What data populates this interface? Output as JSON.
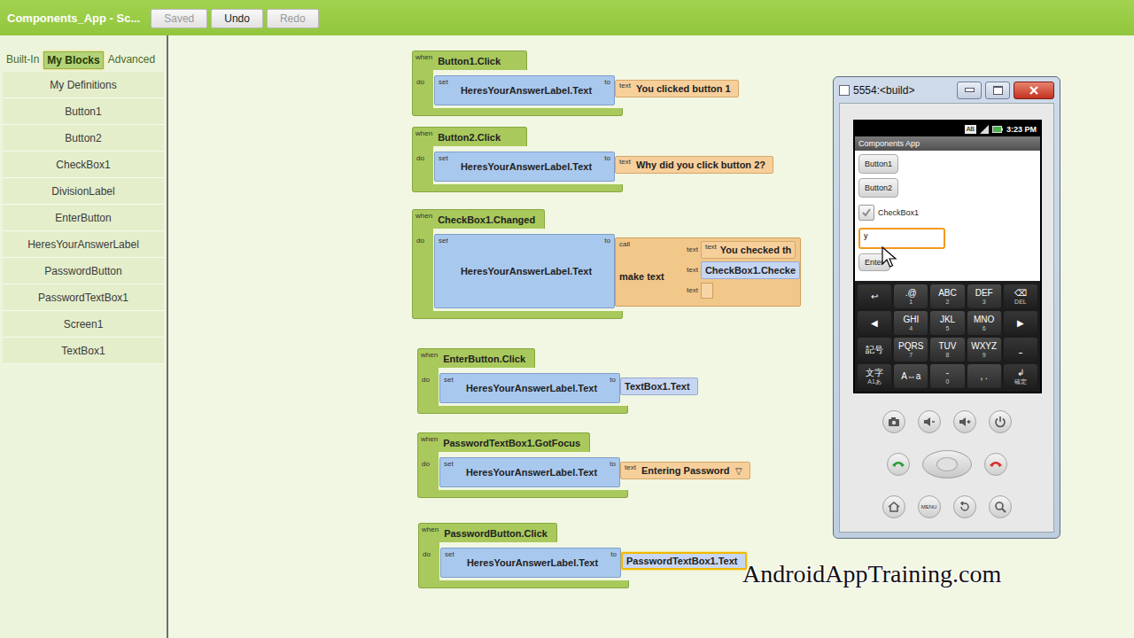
{
  "top_bar": {
    "title": "Components_App - Sc...",
    "buttons": [
      {
        "label": "Saved",
        "disabled": true
      },
      {
        "label": "Undo",
        "disabled": false
      },
      {
        "label": "Redo",
        "disabled": true
      }
    ]
  },
  "sidebar": {
    "tabs": [
      {
        "label": "Built-In",
        "selected": false
      },
      {
        "label": "My Blocks",
        "selected": true
      },
      {
        "label": "Advanced",
        "selected": false
      }
    ],
    "items": [
      "My Definitions",
      "Button1",
      "Button2",
      "CheckBox1",
      "DivisionLabel",
      "EnterButton",
      "HeresYourAnswerLabel",
      "PasswordButton",
      "PasswordTextBox1",
      "Screen1",
      "TextBox1"
    ]
  },
  "block_labels": {
    "when": "when",
    "do": "do",
    "set": "set",
    "to": "to",
    "text": "text",
    "call": "call"
  },
  "blocks": [
    {
      "event": "Button1.Click",
      "target": "HeresYourAnswerLabel.Text",
      "value": {
        "kind": "text",
        "text": "You clicked button 1",
        "selected": false
      }
    },
    {
      "event": "Button2.Click",
      "target": "HeresYourAnswerLabel.Text",
      "value": {
        "kind": "text",
        "text": "Why did you click button 2?",
        "selected": false
      }
    },
    {
      "event": "CheckBox1.Changed",
      "target": "HeresYourAnswerLabel.Text",
      "value": {
        "kind": "call",
        "text": "make text",
        "selected": false,
        "args": [
          {
            "kind": "text",
            "text": "You checked th"
          },
          {
            "kind": "getter",
            "text": "CheckBox1.Checke"
          },
          {
            "kind": "empty",
            "text": ""
          }
        ]
      }
    },
    {
      "event": "EnterButton.Click",
      "target": "HeresYourAnswerLabel.Text",
      "value": {
        "kind": "getter",
        "text": "TextBox1.Text",
        "selected": false
      }
    },
    {
      "event": "PasswordTextBox1.GotFocus",
      "target": "HeresYourAnswerLabel.Text",
      "value": {
        "kind": "text",
        "text": "Entering Password",
        "dropdown": "▽",
        "selected": false
      }
    },
    {
      "event": "PasswordButton.Click",
      "target": "HeresYourAnswerLabel.Text",
      "value": {
        "kind": "getter",
        "text": "PasswordTextBox1.Text",
        "selected": true
      }
    }
  ],
  "emulator": {
    "title": "5554:<build>",
    "phone": {
      "status_badge": "AB",
      "time": "3:23 PM",
      "app_title": "Components App",
      "buttons": [
        "Button1",
        "Button2"
      ],
      "checkbox": {
        "label": "CheckBox1",
        "checked": true
      },
      "textbox": {
        "value": "y",
        "focused": true
      },
      "enter_button": "Enter",
      "keyboard": [
        [
          {
            "main": "↩",
            "sub": "",
            "kind": "function"
          },
          {
            "main": ".@",
            "sub": "1",
            "kind": "char"
          },
          {
            "main": "ABC",
            "sub": "2",
            "kind": "char"
          },
          {
            "main": "DEF",
            "sub": "3",
            "kind": "char"
          },
          {
            "main": "⌫",
            "sub": "DEL",
            "kind": "function"
          }
        ],
        [
          {
            "main": "◀",
            "sub": "",
            "kind": "function"
          },
          {
            "main": "GHI",
            "sub": "4",
            "kind": "char"
          },
          {
            "main": "JKL",
            "sub": "5",
            "kind": "char"
          },
          {
            "main": "MNO",
            "sub": "6",
            "kind": "char"
          },
          {
            "main": "▶",
            "sub": "",
            "kind": "function"
          }
        ],
        [
          {
            "main": "記号",
            "sub": "",
            "kind": "function"
          },
          {
            "main": "PQRS",
            "sub": "7",
            "kind": "char"
          },
          {
            "main": "TUV",
            "sub": "8",
            "kind": "char"
          },
          {
            "main": "WXYZ",
            "sub": "9",
            "kind": "char"
          },
          {
            "main": "⎵",
            "sub": "",
            "kind": "function"
          }
        ],
        [
          {
            "main": "文字",
            "sub": "A1あ",
            "kind": "function"
          },
          {
            "main": "A⇔a",
            "sub": "",
            "kind": "char"
          },
          {
            "main": "-",
            "sub": "0",
            "kind": "char"
          },
          {
            "main": ", .",
            "sub": "",
            "kind": "char"
          },
          {
            "main": "↲",
            "sub": "確定",
            "kind": "function"
          }
        ]
      ],
      "menu_label": "MENU"
    }
  },
  "watermark": "AndroidAppTraining.com"
}
